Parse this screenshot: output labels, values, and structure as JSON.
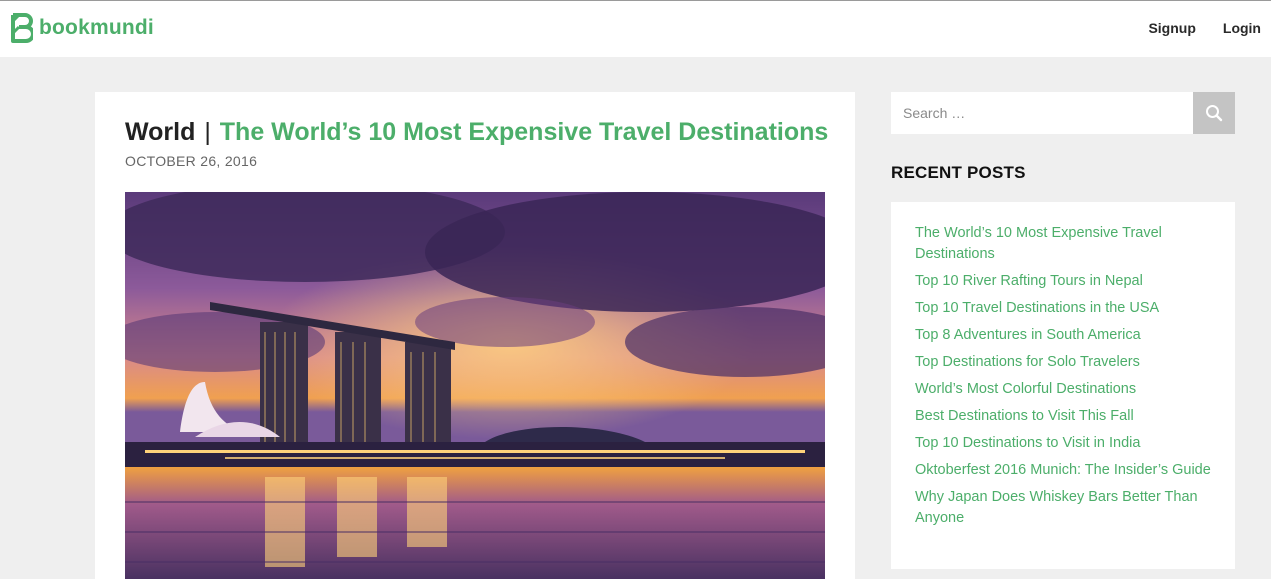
{
  "header": {
    "brand": "bookmundi",
    "nav": [
      {
        "label": "Signup"
      },
      {
        "label": "Login"
      }
    ]
  },
  "article": {
    "category": "World",
    "separator": "|",
    "title": "The World’s 10 Most Expensive Travel Destinations",
    "date": "OCTOBER 26, 2016"
  },
  "sidebar": {
    "search": {
      "placeholder": "Search …"
    },
    "recent_heading": "RECENT POSTS",
    "recent_posts": [
      "The World’s 10 Most Expensive Travel Destinations",
      "Top 10 River Rafting Tours in Nepal",
      "Top 10 Travel Destinations in the USA",
      "Top 8 Adventures in South America",
      "Top Destinations for Solo Travelers",
      "World’s Most Colorful Destinations",
      "Best Destinations to Visit This Fall",
      "Top 10 Destinations to Visit in India",
      "Oktoberfest 2016 Munich: The Insider’s Guide",
      "Why Japan Does Whiskey Bars Better Than Anyone"
    ]
  },
  "colors": {
    "brand_green": "#4cae6a",
    "page_bg": "#efefef",
    "search_button": "#c4c4c4"
  },
  "icons": {
    "logo": "bookmundi-logo-icon",
    "search": "search-icon"
  }
}
